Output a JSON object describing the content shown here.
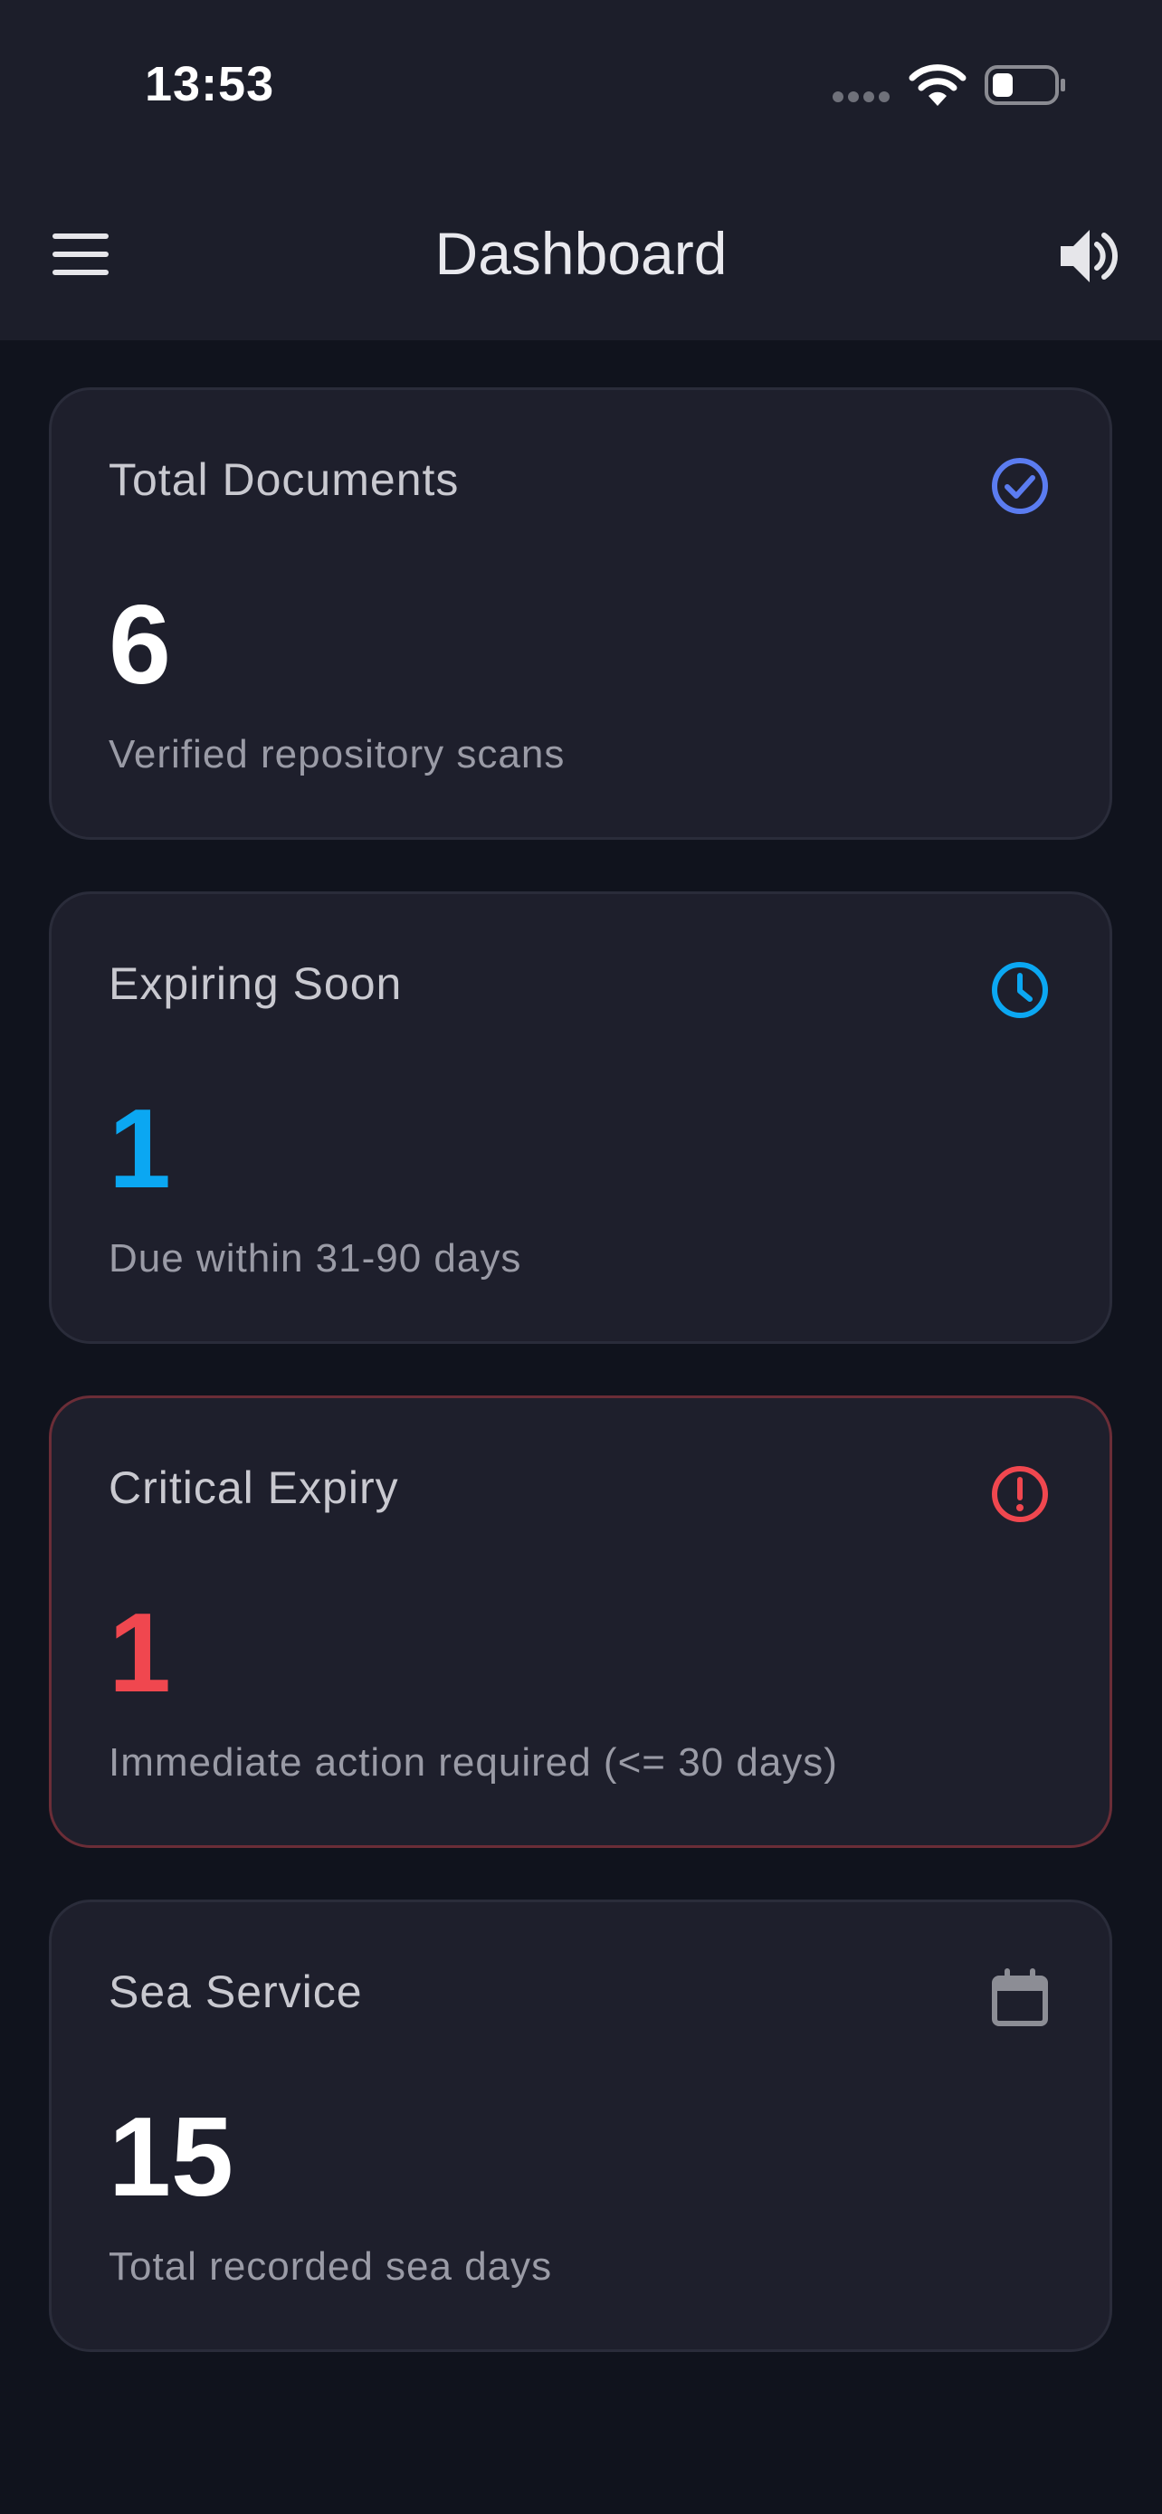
{
  "status_bar": {
    "time": "13:53"
  },
  "app_bar": {
    "title": "Dashboard"
  },
  "cards": [
    {
      "title": "Total Documents",
      "value": "6",
      "subtitle": "Verified repository scans",
      "icon": "check-circle-icon",
      "accent": "#5b7cf0"
    },
    {
      "title": "Expiring Soon",
      "value": "1",
      "subtitle": "Due within 31-90 days",
      "icon": "clock-icon",
      "accent": "#0ba7f2"
    },
    {
      "title": "Critical Expiry",
      "value": "1",
      "subtitle": "Immediate action required (<= 30 days)",
      "icon": "alert-circle-icon",
      "accent": "#f0474f"
    },
    {
      "title": "Sea Service",
      "value": "15",
      "subtitle": "Total recorded sea days",
      "icon": "calendar-icon",
      "accent": "#8c8d95"
    }
  ],
  "colors": {
    "background": "#10131d",
    "card": "#1e1f2c",
    "bar": "#1c1e2a"
  }
}
